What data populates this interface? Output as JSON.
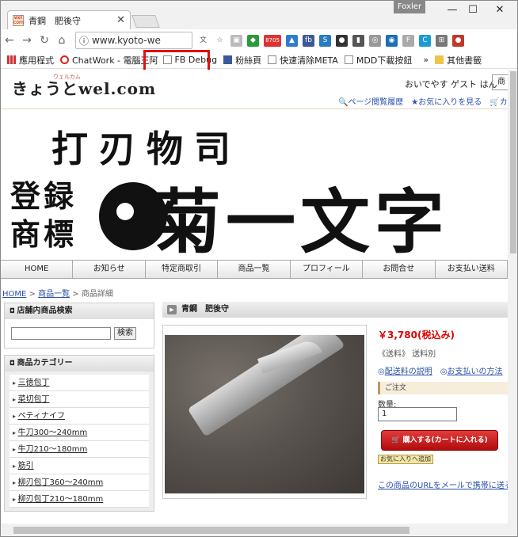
{
  "browser": {
    "tab_title": "青鋼　肥後守",
    "tab_close": "✕",
    "user_name": "Foxler",
    "url": "www.kyoto-we",
    "badge_count": "8705",
    "bookmarks": [
      {
        "label": "應用程式"
      },
      {
        "label": "ChatWork - 電腦王阿"
      },
      {
        "label": "FB Debug"
      },
      {
        "label": "粉絲頁"
      },
      {
        "label": "快速清除META"
      },
      {
        "label": "MDD下載按鈕"
      },
      {
        "label": "其他書籤"
      }
    ],
    "bookmarks_more": "»",
    "highlight_color": "#e01010"
  },
  "site": {
    "logo": "きょうとwel.com",
    "logo_ruby": "ウェルカム",
    "welcome": "おいでやす ゲスト はん",
    "search_btn": "商",
    "header_links": [
      "ページ閲覧履歴",
      "お気に入りを見る",
      "カー"
    ],
    "banner": {
      "top": "打刃物司",
      "left": "登録商標",
      "big": "菊一文字"
    },
    "nav": [
      "HOME",
      "お知らせ",
      "特定商取引",
      "商品一覧",
      "プロフィール",
      "お問合せ",
      "お支払い送料"
    ],
    "breadcrumb": {
      "home": "HOME",
      "sep": " > ",
      "list": "商品一覧",
      "current": "商品詳細"
    },
    "sidebar": {
      "search_title": "店舗内商品検索",
      "search_btn": "検索",
      "category_title": "商品カテゴリー",
      "categories": [
        "三徳包丁",
        "菜切包丁",
        "ペティナイフ",
        "牛刀300～240mm",
        "牛刀210～180mm",
        "筋引",
        "柳刃包丁360～240mm",
        "柳刃包丁210～180mm"
      ]
    },
    "product": {
      "title": "青鋼　肥後守",
      "price": "￥3,780(税込み)",
      "shipping": "《送料》 送料別",
      "link_shipping": "配送料の説明",
      "link_payment": "お支払いの方法",
      "order_title": "ご注文",
      "qty_label": "数量:",
      "qty_value": "1",
      "buy_label": "購入する(カートに入れる)",
      "fav_label": "お気に入りへ追加",
      "mail_link": "この商品のURLをメールで携帯に送る"
    }
  }
}
